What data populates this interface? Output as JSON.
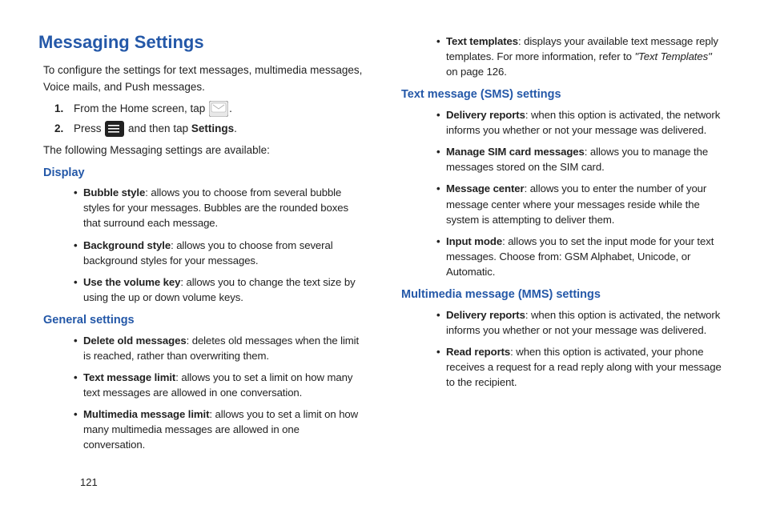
{
  "pageNumber": "121",
  "title": "Messaging Settings",
  "intro": "To configure the settings for text messages, multimedia messages, Voice mails, and Push messages.",
  "step1": {
    "num": "1.",
    "a": "From the Home screen, tap ",
    "b": "."
  },
  "step2": {
    "num": "2.",
    "a": "Press ",
    "b": " and then tap ",
    "c": "Settings",
    "d": "."
  },
  "subtitle": "The following Messaging settings are available:",
  "sections": {
    "display": {
      "heading": "Display",
      "items": [
        {
          "label": "Bubble style",
          "desc": ": allows you to choose from several bubble styles for your messages. Bubbles are the rounded boxes that surround each message."
        },
        {
          "label": "Background style",
          "desc": ": allows you to choose from several background styles for your messages."
        },
        {
          "label": "Use the volume key",
          "desc": ": allows you to change the text size by using the up or down volume keys."
        }
      ]
    },
    "general": {
      "heading": "General settings",
      "items": [
        {
          "label": "Delete old messages",
          "desc": ": deletes old messages when the limit is reached, rather than overwriting them."
        },
        {
          "label": "Text message limit",
          "desc": ": allows you to set a limit on how many text messages are allowed in one conversation."
        },
        {
          "label": "Multimedia message limit",
          "desc": ": allows you to set a limit on how many multimedia messages are allowed in one conversation."
        }
      ]
    },
    "generalCont": {
      "items": [
        {
          "label": "Text templates",
          "desc1": ": displays your available text message reply templates. For more information, refer to ",
          "ref": "\"Text Templates\"",
          "desc2": " on page 126."
        }
      ]
    },
    "sms": {
      "heading": "Text message (SMS) settings",
      "items": [
        {
          "label": "Delivery reports",
          "desc": ": when this option is activated, the network informs you whether or not your message was delivered."
        },
        {
          "label": "Manage SIM card messages",
          "desc": ": allows you to manage the messages stored on the SIM card."
        },
        {
          "label": "Message center",
          "desc": ": allows you to enter the number of your message center where your messages reside while the system is attempting to deliver them."
        },
        {
          "label": "Input mode",
          "desc": ": allows you to set the input mode for your text messages. Choose from: GSM Alphabet, Unicode, or Automatic."
        }
      ]
    },
    "mms": {
      "heading": "Multimedia message (MMS) settings",
      "items": [
        {
          "label": "Delivery reports",
          "desc": ": when this option is activated, the network informs you whether or not your message was delivered."
        },
        {
          "label": "Read reports",
          "desc": ": when this option is activated, your phone receives a request for a read reply along with your message to the recipient."
        }
      ]
    }
  }
}
